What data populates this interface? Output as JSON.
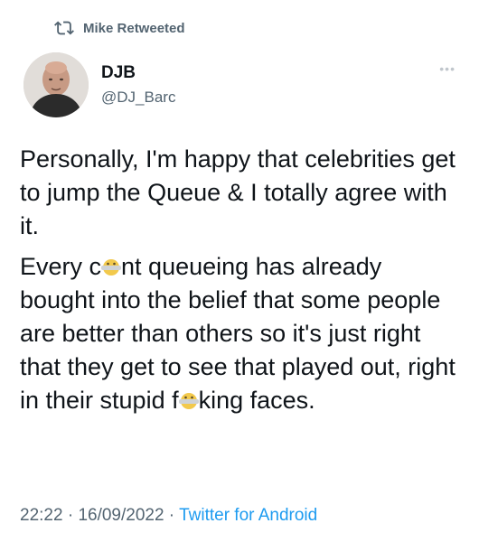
{
  "retweet": {
    "label": "Mike Retweeted",
    "icon": "retweet-icon"
  },
  "author": {
    "display_name": "DJB",
    "handle": "@DJ_Barc",
    "avatar_icon": "profile-photo"
  },
  "more_icon": "ellipsis-icon",
  "more_glyph": "•••",
  "body": {
    "paragraph1": "Personally, I'm happy that celebrities get to jump the Queue & I totally agree with it.",
    "p2_part1": "Every c",
    "p2_part2": "nt queueing has already bought into the belief that some people are better than others so it's just right that they get to see that played out, right in their stupid f",
    "p2_part3": "king faces.",
    "censor_icon": "censor-emoji-icon"
  },
  "meta": {
    "time": "22:22",
    "date": "16/09/2022",
    "separator": " · ",
    "source": "Twitter for Android"
  },
  "colors": {
    "text": "#0f1419",
    "secondary": "#536471",
    "link": "#1d9bf0"
  }
}
